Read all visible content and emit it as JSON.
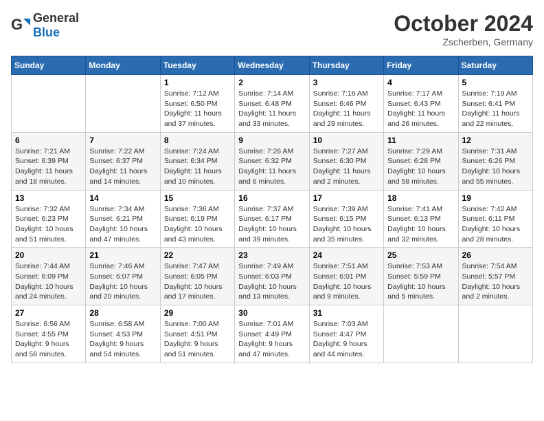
{
  "header": {
    "logo": {
      "general": "General",
      "blue": "Blue"
    },
    "title": "October 2024",
    "location": "Zscherben, Germany"
  },
  "days_of_week": [
    "Sunday",
    "Monday",
    "Tuesday",
    "Wednesday",
    "Thursday",
    "Friday",
    "Saturday"
  ],
  "weeks": [
    [
      {
        "day": "",
        "content": ""
      },
      {
        "day": "",
        "content": ""
      },
      {
        "day": "1",
        "content": "Sunrise: 7:12 AM\nSunset: 6:50 PM\nDaylight: 11 hours and 37 minutes."
      },
      {
        "day": "2",
        "content": "Sunrise: 7:14 AM\nSunset: 6:48 PM\nDaylight: 11 hours and 33 minutes."
      },
      {
        "day": "3",
        "content": "Sunrise: 7:16 AM\nSunset: 6:46 PM\nDaylight: 11 hours and 29 minutes."
      },
      {
        "day": "4",
        "content": "Sunrise: 7:17 AM\nSunset: 6:43 PM\nDaylight: 11 hours and 26 minutes."
      },
      {
        "day": "5",
        "content": "Sunrise: 7:19 AM\nSunset: 6:41 PM\nDaylight: 11 hours and 22 minutes."
      }
    ],
    [
      {
        "day": "6",
        "content": "Sunrise: 7:21 AM\nSunset: 6:39 PM\nDaylight: 11 hours and 18 minutes."
      },
      {
        "day": "7",
        "content": "Sunrise: 7:22 AM\nSunset: 6:37 PM\nDaylight: 11 hours and 14 minutes."
      },
      {
        "day": "8",
        "content": "Sunrise: 7:24 AM\nSunset: 6:34 PM\nDaylight: 11 hours and 10 minutes."
      },
      {
        "day": "9",
        "content": "Sunrise: 7:26 AM\nSunset: 6:32 PM\nDaylight: 11 hours and 6 minutes."
      },
      {
        "day": "10",
        "content": "Sunrise: 7:27 AM\nSunset: 6:30 PM\nDaylight: 11 hours and 2 minutes."
      },
      {
        "day": "11",
        "content": "Sunrise: 7:29 AM\nSunset: 6:28 PM\nDaylight: 10 hours and 58 minutes."
      },
      {
        "day": "12",
        "content": "Sunrise: 7:31 AM\nSunset: 6:26 PM\nDaylight: 10 hours and 55 minutes."
      }
    ],
    [
      {
        "day": "13",
        "content": "Sunrise: 7:32 AM\nSunset: 6:23 PM\nDaylight: 10 hours and 51 minutes."
      },
      {
        "day": "14",
        "content": "Sunrise: 7:34 AM\nSunset: 6:21 PM\nDaylight: 10 hours and 47 minutes."
      },
      {
        "day": "15",
        "content": "Sunrise: 7:36 AM\nSunset: 6:19 PM\nDaylight: 10 hours and 43 minutes."
      },
      {
        "day": "16",
        "content": "Sunrise: 7:37 AM\nSunset: 6:17 PM\nDaylight: 10 hours and 39 minutes."
      },
      {
        "day": "17",
        "content": "Sunrise: 7:39 AM\nSunset: 6:15 PM\nDaylight: 10 hours and 35 minutes."
      },
      {
        "day": "18",
        "content": "Sunrise: 7:41 AM\nSunset: 6:13 PM\nDaylight: 10 hours and 32 minutes."
      },
      {
        "day": "19",
        "content": "Sunrise: 7:42 AM\nSunset: 6:11 PM\nDaylight: 10 hours and 28 minutes."
      }
    ],
    [
      {
        "day": "20",
        "content": "Sunrise: 7:44 AM\nSunset: 6:09 PM\nDaylight: 10 hours and 24 minutes."
      },
      {
        "day": "21",
        "content": "Sunrise: 7:46 AM\nSunset: 6:07 PM\nDaylight: 10 hours and 20 minutes."
      },
      {
        "day": "22",
        "content": "Sunrise: 7:47 AM\nSunset: 6:05 PM\nDaylight: 10 hours and 17 minutes."
      },
      {
        "day": "23",
        "content": "Sunrise: 7:49 AM\nSunset: 6:03 PM\nDaylight: 10 hours and 13 minutes."
      },
      {
        "day": "24",
        "content": "Sunrise: 7:51 AM\nSunset: 6:01 PM\nDaylight: 10 hours and 9 minutes."
      },
      {
        "day": "25",
        "content": "Sunrise: 7:53 AM\nSunset: 5:59 PM\nDaylight: 10 hours and 5 minutes."
      },
      {
        "day": "26",
        "content": "Sunrise: 7:54 AM\nSunset: 5:57 PM\nDaylight: 10 hours and 2 minutes."
      }
    ],
    [
      {
        "day": "27",
        "content": "Sunrise: 6:56 AM\nSunset: 4:55 PM\nDaylight: 9 hours and 58 minutes."
      },
      {
        "day": "28",
        "content": "Sunrise: 6:58 AM\nSunset: 4:53 PM\nDaylight: 9 hours and 54 minutes."
      },
      {
        "day": "29",
        "content": "Sunrise: 7:00 AM\nSunset: 4:51 PM\nDaylight: 9 hours and 51 minutes."
      },
      {
        "day": "30",
        "content": "Sunrise: 7:01 AM\nSunset: 4:49 PM\nDaylight: 9 hours and 47 minutes."
      },
      {
        "day": "31",
        "content": "Sunrise: 7:03 AM\nSunset: 4:47 PM\nDaylight: 9 hours and 44 minutes."
      },
      {
        "day": "",
        "content": ""
      },
      {
        "day": "",
        "content": ""
      }
    ]
  ]
}
